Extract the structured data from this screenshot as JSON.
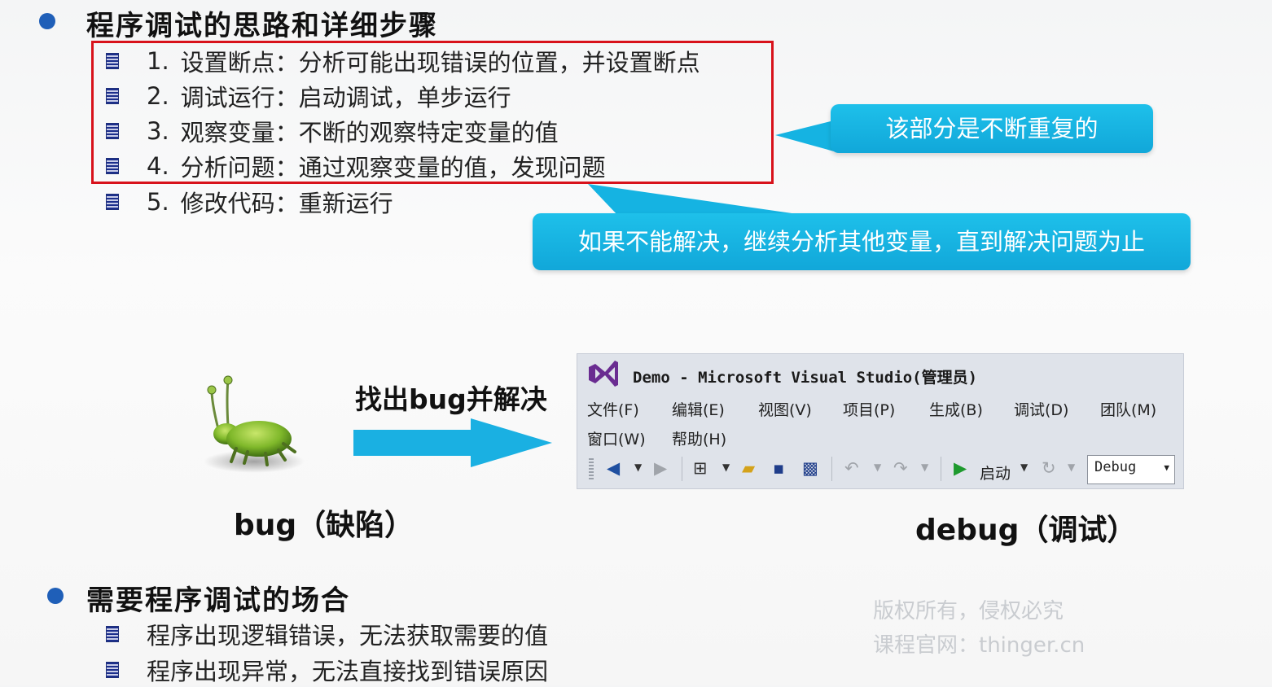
{
  "section1": {
    "title": "程序调试的思路和详细步骤",
    "steps": [
      {
        "num": "1.",
        "text": "设置断点：分析可能出现错误的位置，并设置断点"
      },
      {
        "num": "2.",
        "text": "调试运行：启动调试，单步运行"
      },
      {
        "num": "3.",
        "text": "观察变量：不断的观察特定变量的值"
      },
      {
        "num": "4.",
        "text": "分析问题：通过观察变量的值，发现问题"
      },
      {
        "num": "5.",
        "text": "修改代码：重新运行"
      }
    ]
  },
  "callouts": {
    "repeat": "该部分是不断重复的",
    "continue": "如果不能解决，继续分析其他变量，直到解决问题为止"
  },
  "bug": {
    "arrow_label": "找出bug并解决",
    "bug_label": "bug（缺陷）",
    "debug_label": "debug（调试）"
  },
  "vs": {
    "title": "Demo - Microsoft Visual Studio(管理员)",
    "menu": [
      "文件(F)",
      "编辑(E)",
      "视图(V)",
      "项目(P)",
      "生成(B)",
      "调试(D)",
      "团队(M)",
      "窗口(W)",
      "帮助(H)"
    ],
    "start_label": "启动",
    "config_value": "Debug"
  },
  "section2": {
    "title": "需要程序调试的场合",
    "items": [
      "程序出现逻辑错误，无法获取需要的值",
      "程序出现异常，无法直接找到错误原因"
    ]
  },
  "watermark": {
    "line1": "版权所有，侵权必究",
    "line2": "课程官网：thinger.cn"
  },
  "colors": {
    "bullet": "#1f5fb8",
    "highlight_border": "#d8121b",
    "callout_bg": "#15b3e2",
    "arrow": "#1ab0e2"
  }
}
